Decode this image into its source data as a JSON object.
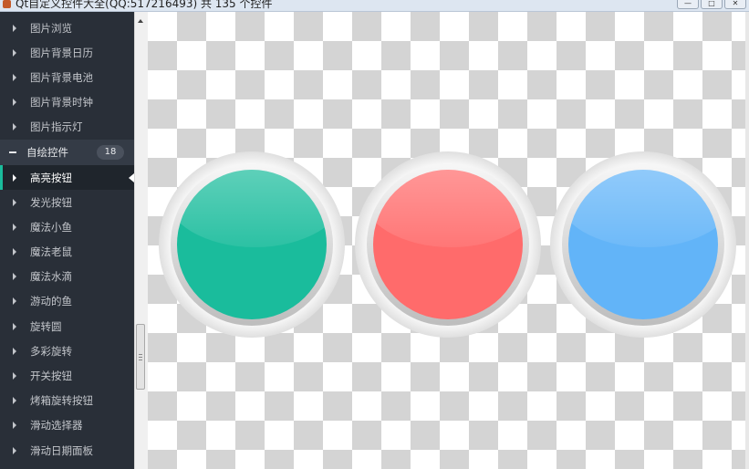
{
  "window": {
    "title": "Qt自定义控件大全(QQ:517216493) 共 135 个控件",
    "minimize_symbol": "—",
    "maximize_symbol": "□",
    "close_symbol": "✕"
  },
  "sidebar": {
    "items_top": [
      {
        "label": "图片浏览"
      },
      {
        "label": "图片背景日历"
      },
      {
        "label": "图片背景电池"
      },
      {
        "label": "图片背景时钟"
      },
      {
        "label": "图片指示灯"
      }
    ],
    "group": {
      "label": "自绘控件",
      "count": "18"
    },
    "items": [
      {
        "label": "高亮按钮",
        "active": true
      },
      {
        "label": "发光按钮"
      },
      {
        "label": "魔法小鱼"
      },
      {
        "label": "魔法老鼠"
      },
      {
        "label": "魔法水滴"
      },
      {
        "label": "游动的鱼"
      },
      {
        "label": "旋转圆"
      },
      {
        "label": "多彩旋转"
      },
      {
        "label": "开关按钮"
      },
      {
        "label": "烤箱旋转按钮"
      },
      {
        "label": "滑动选择器"
      },
      {
        "label": "滑动日期面板"
      }
    ]
  },
  "colors": {
    "sidebar_bg": "#292f38",
    "accent": "#1abc9c",
    "light_green": "#1abc9c",
    "light_red": "#ff6b6b",
    "light_blue": "#62b4f8"
  },
  "lights": [
    {
      "name": "green",
      "color": "#1abc9c"
    },
    {
      "name": "red",
      "color": "#ff6b6b"
    },
    {
      "name": "blue",
      "color": "#62b4f8"
    }
  ]
}
